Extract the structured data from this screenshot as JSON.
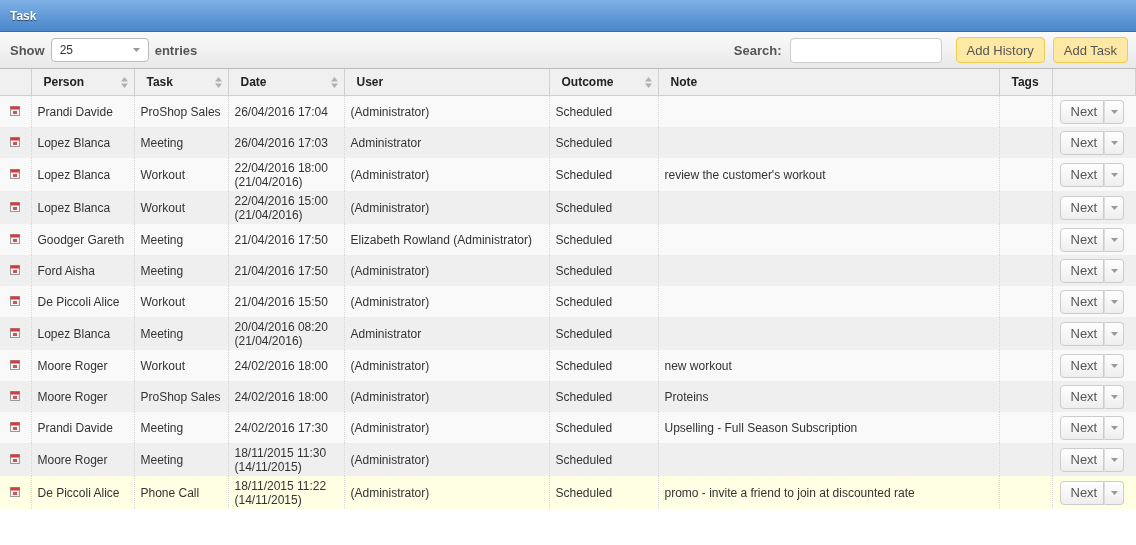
{
  "window": {
    "title": "Task"
  },
  "toolbar": {
    "show_label": "Show",
    "page_size": "25",
    "entries_label": "entries",
    "search_label": "Search:",
    "buttons": [
      "Add History",
      "Add Task"
    ]
  },
  "table": {
    "columns": [
      {
        "label": "Person",
        "sortable": true
      },
      {
        "label": "Task",
        "sortable": true
      },
      {
        "label": "Date",
        "sortable": true
      },
      {
        "label": "User",
        "sortable": false
      },
      {
        "label": "Outcome",
        "sortable": true
      },
      {
        "label": "Note",
        "sortable": false
      },
      {
        "label": "Tags",
        "sortable": false
      }
    ],
    "rows": [
      {
        "person": "Prandi Davide",
        "task": "ProShop Sales",
        "date": [
          "26/04/2016 17:04"
        ],
        "user": "(Administrator)",
        "outcome": "Scheduled",
        "note": "",
        "action": "Next",
        "highlighted": false
      },
      {
        "person": "Lopez Blanca",
        "task": "Meeting",
        "date": [
          "26/04/2016 17:03"
        ],
        "user": "Administrator",
        "outcome": "Scheduled",
        "note": "",
        "action": "Next",
        "highlighted": false
      },
      {
        "person": "Lopez Blanca",
        "task": "Workout",
        "date": [
          "22/04/2016 18:00",
          "(21/04/2016)"
        ],
        "user": "(Administrator)",
        "outcome": "Scheduled",
        "note": "review the customer's workout",
        "action": "Next",
        "highlighted": false
      },
      {
        "person": "Lopez Blanca",
        "task": "Workout",
        "date": [
          "22/04/2016 15:00",
          "(21/04/2016)"
        ],
        "user": "(Administrator)",
        "outcome": "Scheduled",
        "note": "",
        "action": "Next",
        "highlighted": false
      },
      {
        "person": "Goodger Gareth",
        "task": "Meeting",
        "date": [
          "21/04/2016 17:50"
        ],
        "user": "Elizabeth Rowland (Administrator)",
        "outcome": "Scheduled",
        "note": "",
        "action": "Next",
        "highlighted": false
      },
      {
        "person": "Ford Aisha",
        "task": "Meeting",
        "date": [
          "21/04/2016 17:50"
        ],
        "user": "(Administrator)",
        "outcome": "Scheduled",
        "note": "",
        "action": "Next",
        "highlighted": false
      },
      {
        "person": "De Piccoli Alice",
        "task": "Workout",
        "date": [
          "21/04/2016 15:50"
        ],
        "user": "(Administrator)",
        "outcome": "Scheduled",
        "note": "",
        "action": "Next",
        "highlighted": false
      },
      {
        "person": "Lopez Blanca",
        "task": "Meeting",
        "date": [
          "20/04/2016 08:20",
          "(21/04/2016)"
        ],
        "user": "Administrator",
        "outcome": "Scheduled",
        "note": "",
        "action": "Next",
        "highlighted": false
      },
      {
        "person": "Moore Roger",
        "task": "Workout",
        "date": [
          "24/02/2016 18:00"
        ],
        "user": "(Administrator)",
        "outcome": "Scheduled",
        "note": "new workout",
        "action": "Next",
        "highlighted": false
      },
      {
        "person": "Moore Roger",
        "task": "ProShop Sales",
        "date": [
          "24/02/2016 18:00"
        ],
        "user": "(Administrator)",
        "outcome": "Scheduled",
        "note": "Proteins",
        "action": "Next",
        "highlighted": false
      },
      {
        "person": "Prandi Davide",
        "task": "Meeting",
        "date": [
          "24/02/2016 17:30"
        ],
        "user": "(Administrator)",
        "outcome": "Scheduled",
        "note": "Upselling - Full Season Subscription",
        "action": "Next",
        "highlighted": false
      },
      {
        "person": "Moore Roger",
        "task": "Meeting",
        "date": [
          "18/11/2015 11:30",
          "(14/11/2015)"
        ],
        "user": "(Administrator)",
        "outcome": "Scheduled",
        "note": "",
        "action": "Next",
        "highlighted": false
      },
      {
        "person": "De Piccoli Alice",
        "task": "Phone Call",
        "date": [
          "18/11/2015 11:22",
          "(14/11/2015)"
        ],
        "user": "(Administrator)",
        "outcome": "Scheduled",
        "note": "promo - invite a friend to join at discounted rate",
        "action": "Next",
        "highlighted": true
      }
    ]
  }
}
